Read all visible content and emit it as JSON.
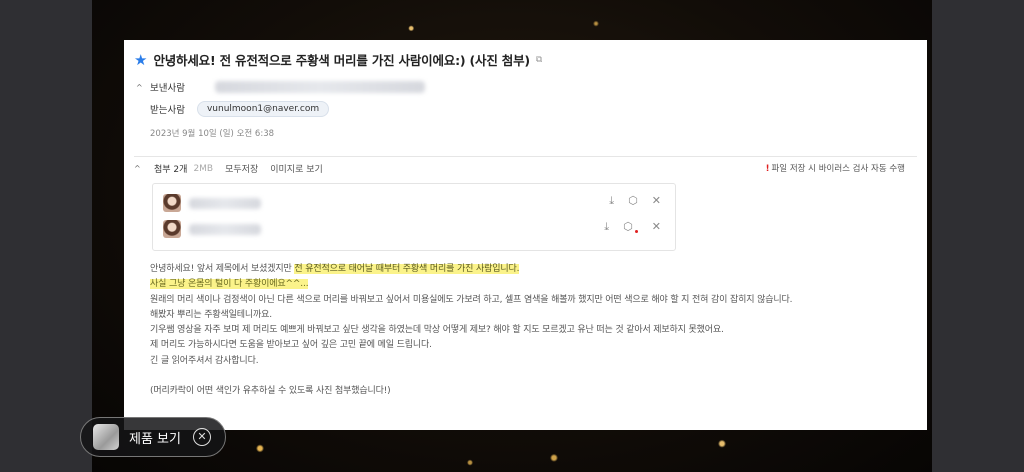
{
  "email": {
    "subject": "안녕하세요! 전 유전적으로 주황색 머리를 가진 사람이에요:) (사진 첨부)",
    "from_label": "보낸사람",
    "to_label": "받는사람",
    "to_address": "vunulmoon1@naver.com",
    "date": "2023년 9월 10일 (일) 오전 6:38",
    "attachments": {
      "label": "첨부 2개",
      "size": "2MB",
      "save_all": "모두저장",
      "view_as_image": "이미지로 보기",
      "scan_notice": "파일 저장 시 바이러스 검사 자동 수행",
      "scan_mark": "!"
    },
    "body_lines": [
      {
        "pre": "안녕하세요! 앞서 제목에서 보셨겠지만 ",
        "hl": "전 유전적으로 태어날 때부터 주황색 머리를 가진 사람입니다."
      },
      {
        "pre": "",
        "hl": "사실 그냥 온몸의 털이 다 주황이에요^^..."
      },
      {
        "pre": "원래의 머리 색이나 검정색이 아닌 다른 색으로 머리를 바꿔보고 싶어서 미용실에도 가보려 하고, 셀프 염색을 해볼까 했지만 어떤 색으로 해야 할 지 전혀 감이 잡히지 않습니다.",
        "hl": ""
      },
      {
        "pre": "해봤자 뿌리는 주황색일테니까요.",
        "hl": ""
      },
      {
        "pre": "기우쌤 영상을 자주 보며 제 머리도 예쁘게 바꿔보고 싶단 생각을 하였는데 막상 어떻게 제보? 해야 할 지도 모르겠고 유난 떠는 것 같아서 제보하지 못했어요.",
        "hl": ""
      },
      {
        "pre": "제 머리도 가능하시다면 도움을 받아보고 싶어 깊은 고민 끝에 메일 드립니다.",
        "hl": ""
      },
      {
        "pre": "긴 글 읽어주셔서 감사합니다.",
        "hl": ""
      },
      {
        "pre": "",
        "hl": ""
      },
      {
        "pre": "(머리카락이 어떤 색인가 유추하실 수 있도록 사진 첨부했습니다!)",
        "hl": ""
      }
    ]
  },
  "overlay": {
    "product_label": "제품 보기"
  },
  "icons": {
    "star": "★",
    "external": "⧉",
    "caret": "^",
    "download": "⤓",
    "scan": "⬡",
    "close": "✕"
  },
  "colors": {
    "accent_star": "#2b7de9",
    "highlight": "#fbf38a",
    "warning": "#e02020"
  }
}
